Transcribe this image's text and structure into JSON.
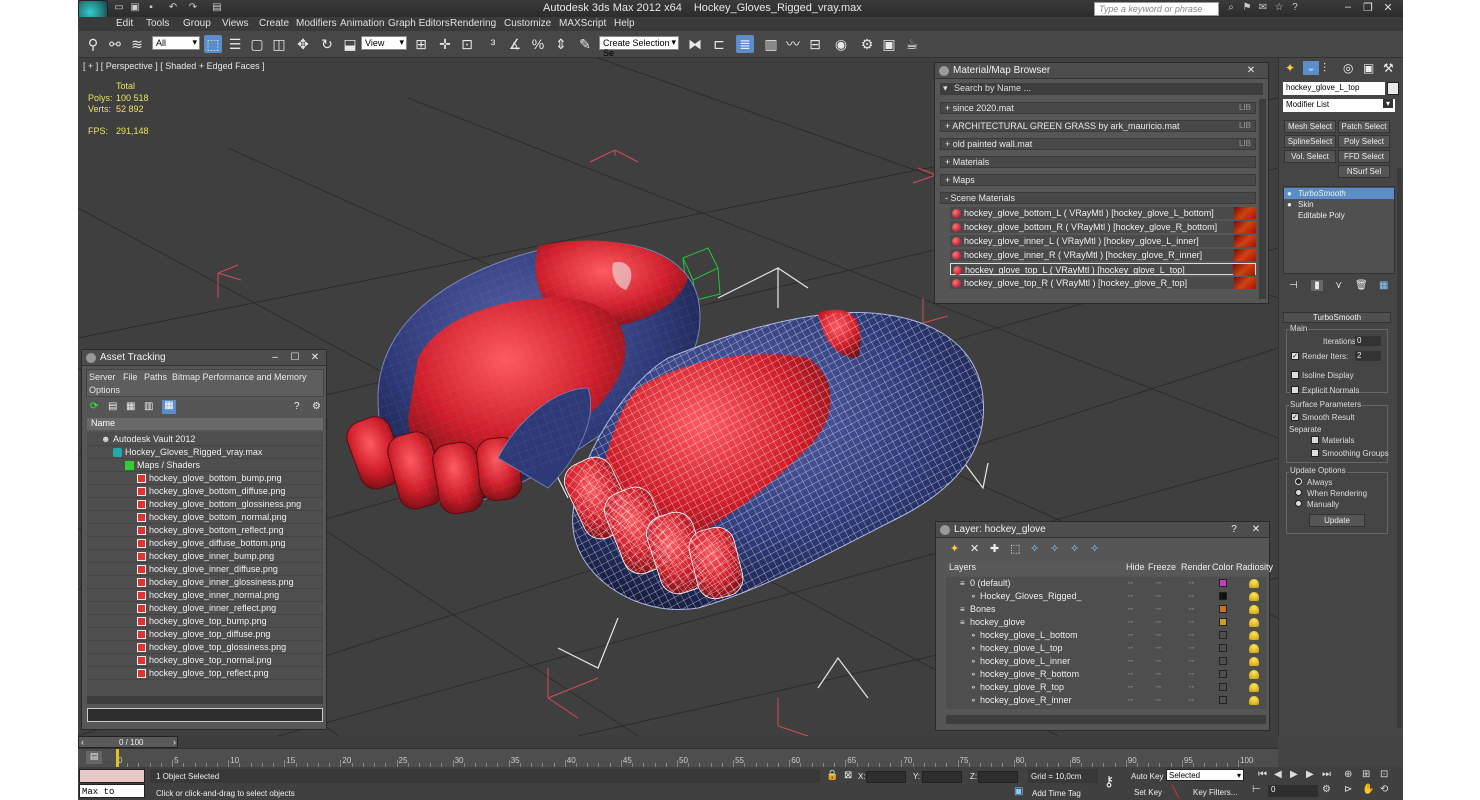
{
  "window": {
    "app_title": "Autodesk 3ds Max  2012 x64",
    "file_title": "Hockey_Gloves_Rigged_vray.max",
    "search_placeholder": "Type a keyword or phrase"
  },
  "menu": [
    "Edit",
    "Tools",
    "Group",
    "Views",
    "Create",
    "Modifiers",
    "Animation",
    "Graph Editors",
    "Rendering",
    "Customize",
    "MAXScript",
    "Help"
  ],
  "toolbar": {
    "selection_filter": "All",
    "ref_coord": "View",
    "named_selection": "Create Selection Se",
    "icons": [
      "link-icon",
      "unlink-icon",
      "bind-space-warp-icon",
      "select-object-icon",
      "select-by-name-icon",
      "rect-select-icon",
      "window-crossing-icon",
      "move-icon",
      "rotate-icon",
      "scale-icon",
      "pivot-icon",
      "manipulate-icon",
      "snap-icon",
      "angle-snap-icon",
      "percent-snap-icon",
      "spinner-snap-icon",
      "mirror-icon",
      "align-icon",
      "layer-manager-icon",
      "graphite-icon",
      "curve-editor-icon",
      "schematic-icon",
      "material-editor-icon",
      "render-setup-icon",
      "rendered-frame-icon",
      "render-icon"
    ]
  },
  "viewport": {
    "label": "[ + ] [ Perspective ] [ Shaded + Edged Faces ]",
    "stats": {
      "total_label": "Total",
      "polys_label": "Polys:",
      "polys": "100 518",
      "verts_label": "Verts:",
      "verts": "52 892",
      "fps_label": "FPS:",
      "fps": "291,148"
    },
    "colors": {
      "glove_red": "#cf1e2a",
      "glove_blue": "#2e3a78",
      "grid": "#2b2b2b",
      "bbox": "#d34b5a"
    }
  },
  "material_browser": {
    "title": "Material/Map Browser",
    "search": "Search by Name ...",
    "groups": [
      {
        "label": "+ since 2020.mat",
        "tag": "LIB"
      },
      {
        "label": "+ ARCHITECTURAL GREEN GRASS by ark_mauricio.mat",
        "tag": "LIB"
      },
      {
        "label": "+ old painted wall.mat",
        "tag": "LIB"
      },
      {
        "label": "+ Materials",
        "tag": ""
      },
      {
        "label": "+ Maps",
        "tag": ""
      },
      {
        "label": "- Scene Materials",
        "tag": ""
      }
    ],
    "scene_materials": [
      "hockey_glove_bottom_L  ( VRayMtl ) [hockey_glove_L_bottom]",
      "hockey_glove_bottom_R  ( VRayMtl ) [hockey_glove_R_bottom]",
      "hockey_glove_inner_L  ( VRayMtl ) [hockey_glove_L_inner]",
      "hockey_glove_inner_R  ( VRayMtl ) [hockey_glove_R_inner]",
      "hockey_glove_top_L  ( VRayMtl ) [hockey_glove_L_top]",
      "hockey_glove_top_R  ( VRayMtl ) [hockey_glove_R_top]"
    ]
  },
  "asset_tracking": {
    "title": "Asset Tracking",
    "menu": [
      "Server",
      "File",
      "Paths",
      "Bitmap Performance and Memory"
    ],
    "menu2": "Options",
    "column": "Name",
    "vault": "Autodesk Vault 2012",
    "file": "Hockey_Gloves_Rigged_vray.max",
    "folder": "Maps / Shaders",
    "maps": [
      "hockey_glove_bottom_bump.png",
      "hockey_glove_bottom_diffuse.png",
      "hockey_glove_bottom_glossiness.png",
      "hockey_glove_bottom_normal.png",
      "hockey_glove_bottom_reflect.png",
      "hockey_glove_diffuse_bottom.png",
      "hockey_glove_inner_bump.png",
      "hockey_glove_inner_diffuse.png",
      "hockey_glove_inner_glossiness.png",
      "hockey_glove_inner_normal.png",
      "hockey_glove_inner_reflect.png",
      "hockey_glove_top_bump.png",
      "hockey_glove_top_diffuse.png",
      "hockey_glove_top_glossiness.png",
      "hockey_glove_top_normal.png",
      "hockey_glove_top_reflect.png"
    ]
  },
  "layer_panel": {
    "title": "Layer: hockey_glove",
    "columns": [
      "Layers",
      "Hide",
      "Freeze",
      "Render",
      "Color",
      "Radiosity"
    ],
    "rows": [
      {
        "name": "0 (default)",
        "color": "#c040c0"
      },
      {
        "name": "Hockey_Gloves_Rigged_",
        "color": "#111111"
      },
      {
        "name": "Bones",
        "color": "#d07020"
      },
      {
        "name": "hockey_glove",
        "color": "#c8a020"
      },
      {
        "name": "hockey_glove_L_bottom",
        "color": ""
      },
      {
        "name": "hockey_glove_L_top",
        "color": ""
      },
      {
        "name": "hockey_glove_L_inner",
        "color": ""
      },
      {
        "name": "hockey_glove_R_bottom",
        "color": ""
      },
      {
        "name": "hockey_glove_R_top",
        "color": ""
      },
      {
        "name": "hockey_glove_R_inner",
        "color": ""
      }
    ]
  },
  "command_panel": {
    "object_name": "hockey_glove_L_top",
    "modifier_list": "Modifier List",
    "buttons": [
      "Mesh Select",
      "Patch Select",
      "SplineSelect",
      "Poly Select",
      "Vol. Select",
      "FFD Select",
      "NSurf Sel"
    ],
    "stack": [
      "TurboSmooth",
      "Skin",
      "Editable Poly"
    ],
    "turbosmooth": {
      "title": "TurboSmooth",
      "main": "Main",
      "iterations_label": "Iterations:",
      "iterations": "0",
      "render_iters_label": "Render Iters:",
      "render_iters": "2",
      "isoline": "Isoline Display",
      "explicit": "Explicit Normals",
      "surface": "Surface Parameters",
      "smooth_result": "Smooth Result",
      "separate": "Separate",
      "materials": "Materials",
      "smoothing_groups": "Smoothing Groups",
      "update_options": "Update Options",
      "always": "Always",
      "when_rendering": "When Rendering",
      "manually": "Manually",
      "update": "Update"
    }
  },
  "timeline": {
    "frame": "0 / 100",
    "ticks": [
      "0",
      "5",
      "10",
      "15",
      "20",
      "25",
      "30",
      "35",
      "40",
      "45",
      "50",
      "55",
      "60",
      "65",
      "70",
      "75",
      "80",
      "85",
      "90",
      "95",
      "100"
    ]
  },
  "status": {
    "maxscript": "Max to Physc.",
    "selected": "1 Object Selected",
    "prompt": "Click or click-and-drag to select objects",
    "x": "X:",
    "y": "Y:",
    "z": "Z:",
    "grid": "Grid = 10,0cm",
    "add_time_tag": "Add Time Tag",
    "auto_key": "Auto Key",
    "selected_dd": "Selected",
    "set_key": "Set Key",
    "key_filters": "Key Filters...",
    "frame": "0"
  }
}
